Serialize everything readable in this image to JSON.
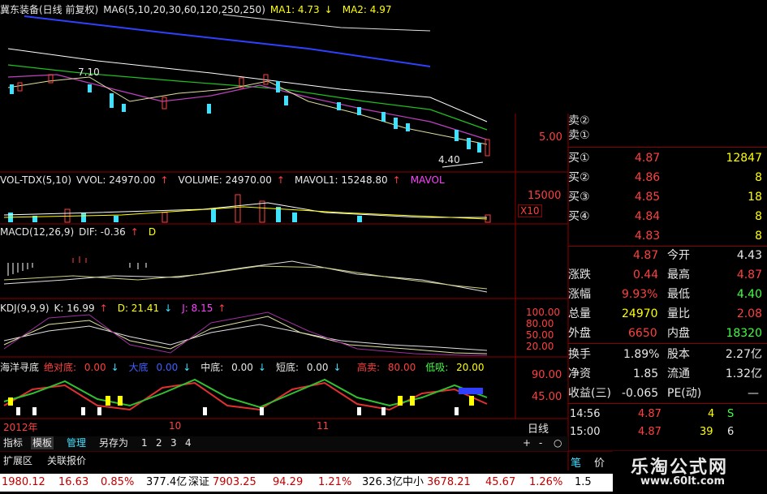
{
  "header": {
    "stock": "冀东装备(日线 前复权)",
    "ma_label": "MA6(5,10,20,30,60,120,250,250)",
    "ma1": "MA1: 4.73",
    "ma1_arrow": "↓",
    "ma2": "MA2: 4.97"
  },
  "price_panel": {
    "high_label": "7.10",
    "low_label": "4.40",
    "axis": [
      "5.00"
    ]
  },
  "vol_panel": {
    "title": "VOL-TDX(5,10)",
    "vvol": "VVOL: 24970.00",
    "vvol_arrow": "↑",
    "volume": "VOLUME: 24970.00",
    "volume_arrow": "↑",
    "mavol1": "MAVOL1: 15248.80",
    "mavol1_arrow": "↑",
    "mavol": "MAVOL",
    "axis": [
      "15000"
    ],
    "unit": "X10"
  },
  "macd_panel": {
    "title": "MACD(12,26,9)",
    "dif": "DIF: -0.36",
    "dif_arrow": "↑",
    "dea": "D"
  },
  "kdj_panel": {
    "title": "KDJ(9,9,9)",
    "k": "K: 16.99",
    "k_arrow": "↑",
    "d": "D: 21.41",
    "d_arrow": "↓",
    "j": "J: 8.15",
    "j_arrow": "↑",
    "axis": [
      "100.00",
      "80.00",
      "50.00",
      "20.00"
    ]
  },
  "hy_panel": {
    "title": "海洋寻底",
    "juedi_label": "绝对底:",
    "juedi": "0.00",
    "juedi_arrow": "↓",
    "dadi_label": "大底",
    "dadi": "0.00",
    "dadi_arrow": "↓",
    "zhongdi_label": "中底:",
    "zhongdi": "0.00",
    "zhongdi_arrow": "↓",
    "duandi_label": "短底:",
    "duandi": "0.00",
    "duandi_arrow": "↓",
    "gaomai_label": "高卖:",
    "gaomai": "80.00",
    "dixi_label": "低吸:",
    "dixi": "20.00",
    "axis": [
      "90.00",
      "45.00"
    ]
  },
  "date_axis": {
    "year": "2012年",
    "m10": "10",
    "m11": "11",
    "period": "日线"
  },
  "tabs": {
    "zhibiao": "指标",
    "moban": "模板",
    "guanli": "管理",
    "lingcun": "另存为",
    "n1": "1",
    "n2": "2",
    "n3": "3",
    "n4": "4",
    "plus": "+",
    "minus": "-",
    "circle": "○"
  },
  "tabs2": {
    "kuozhan": "扩展区",
    "guanlian": "关联报价"
  },
  "orderbook": {
    "sell": [
      {
        "label": "卖②"
      },
      {
        "label": "卖①"
      }
    ],
    "buy": [
      {
        "label": "买①",
        "price": "4.87",
        "vol": "12847"
      },
      {
        "label": "买②",
        "price": "4.86",
        "vol": "8"
      },
      {
        "label": "买③",
        "price": "4.85",
        "vol": "18"
      },
      {
        "label": "买④",
        "price": "4.84",
        "vol": "8"
      },
      {
        "label": "",
        "price": "4.83",
        "vol": "8"
      }
    ]
  },
  "quote": [
    {
      "l1": "",
      "v1": "4.87",
      "l2": "今开",
      "v2": "4.43"
    },
    {
      "l1": "涨跌",
      "v1": "0.44",
      "l2": "最高",
      "v2": "4.87"
    },
    {
      "l1": "涨幅",
      "v1": "9.93%",
      "l2": "最低",
      "v2": "4.40"
    },
    {
      "l1": "总量",
      "v1": "24970",
      "l2": "量比",
      "v2": "2.08"
    },
    {
      "l1": "外盘",
      "v1": "6650",
      "l2": "内盘",
      "v2": "18320"
    },
    {
      "l1": "换手",
      "v1": "1.89%",
      "l2": "股本",
      "v2": "2.27亿"
    },
    {
      "l1": "净资",
      "v1": "1.85",
      "l2": "流通",
      "v2": "1.32亿"
    },
    {
      "l1": "收益(三)",
      "v1": "-0.065",
      "l2": "PE(动)",
      "v2": "—"
    }
  ],
  "ticks": [
    {
      "time": "14:56",
      "price": "4.87",
      "vol": "4",
      "flag": "S"
    },
    {
      "time": "15:00",
      "price": "4.87",
      "vol": "39",
      "flag": "6"
    }
  ],
  "side_tabs": {
    "bi": "笔",
    "jia": "价"
  },
  "watermark": {
    "name": "乐淘公式网",
    "url": "www.60lt.com"
  },
  "status": {
    "sh": "1980.12",
    "sh_chg": "16.63",
    "sh_pct": "0.85%",
    "sh_amt": "377.4亿",
    "sz_label": "深证",
    "sz": "7903.25",
    "sz_chg": "94.29",
    "sz_pct": "1.21%",
    "sz_amt": "326.3亿",
    "zx_label": "中小",
    "zx": "3678.21",
    "zx_chg": "45.67",
    "zx_pct": "1.26%",
    "tail": "1.5"
  }
}
